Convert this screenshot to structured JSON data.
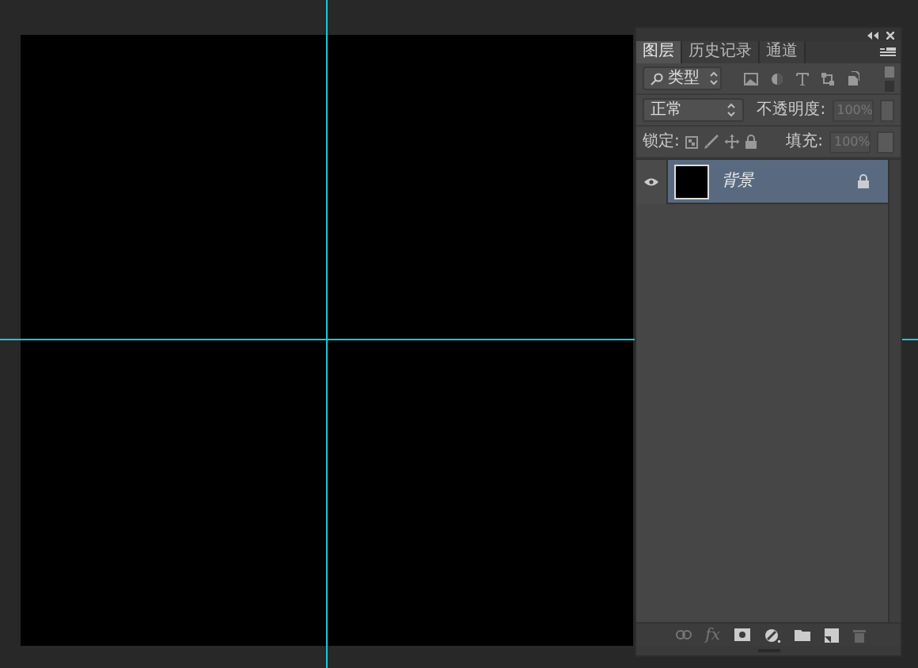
{
  "tabs": [
    {
      "label": "图层",
      "selected": true
    },
    {
      "label": "历史记录",
      "selected": false
    },
    {
      "label": "通道",
      "selected": false
    }
  ],
  "filter": {
    "value": "类型"
  },
  "blend_mode": {
    "value": "正常"
  },
  "opacity": {
    "label": "不透明度:",
    "value": "100%",
    "disabled": true
  },
  "lock": {
    "label": "锁定:"
  },
  "fill": {
    "label": "填充:",
    "value": "100%",
    "disabled": true
  },
  "layers": [
    {
      "name": "背景",
      "selected": true,
      "visible": true,
      "locked": true
    }
  ],
  "footer": {
    "effects": "fx"
  }
}
